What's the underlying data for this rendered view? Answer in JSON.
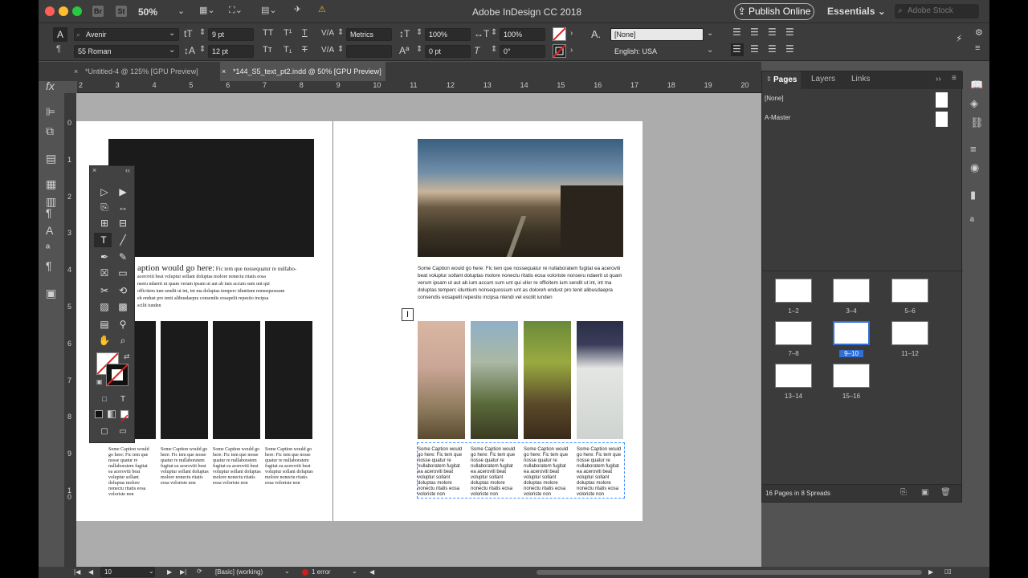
{
  "window": {
    "title": "Adobe InDesign CC 2018",
    "zoom": "50%",
    "workspace": "Essentials",
    "publish": "Publish Online",
    "stock_placeholder": "Adobe Stock"
  },
  "appbar": {
    "br": "Br",
    "st": "St"
  },
  "control": {
    "font_family": "Avenir",
    "font_style": "55 Roman",
    "size": "9 pt",
    "leading": "12 pt",
    "kerning": "Metrics",
    "vscale": "100%",
    "hscale": "100%",
    "baseline": "0 pt",
    "skew": "0°",
    "char_style": "[None]",
    "language": "English: USA"
  },
  "tabs": [
    "*Untitled-4 @ 125% [GPU Preview]",
    "*144_S5_text_pt2.indd @ 50% [GPU Preview]"
  ],
  "ruler_h": [
    "2",
    "3",
    "4",
    "5",
    "6",
    "7",
    "8",
    "9",
    "10",
    "11",
    "12",
    "13",
    "14",
    "15",
    "16",
    "17",
    "18",
    "19",
    "20"
  ],
  "ruler_v": [
    "0",
    "1",
    "2",
    "3",
    "4",
    "5",
    "6",
    "7",
    "8",
    "9",
    "1\n0"
  ],
  "doc": {
    "caption_lead": "Some Caption would go here:",
    "caption_lead_left": "aption would go here:",
    "caption_body": "Fic tem que nossequatur re nullaboratem fugitat ea aceroviti beat voluptur sollant doluptas molore nonectu ritatis eosa voloriste nonseru ndaerit ut quam verum ipsam ut aut ab ium accum sum unt qui ullor re officitem ium sendit ut int, int ma doluptas temperc iduntium nonsequossum unt as doloreh endust pro tenit alibusdaepra consendis eosapelit repestio incipsa ntendi vel escilit iunden",
    "caption_left_lines": [
      "aceroviti beat voluptur sollant doluptas molore nonectu ritatis eosa",
      "nseru ndaerit ut quam verum ipsam ut aut ab ium accum sum unt qui",
      "officitem ium sendit ut int, int ma doluptas temperc iduntium nonsequossum",
      "eh endust pro tenit alibusdaepra consendis eosapelit repestio incipsa",
      "scilit iunden"
    ],
    "small_caption": "Some Caption would go here: Fic tem que nosse quatur re nullaboratem fugitat ea aceroviti beat voluptur sollant doluptas molore nonectu ritatis eosa voloriste non",
    "small_caption_left": "Some Caption would go here: Fic tem que nosse quatur re nullaboratem fugitat ea aceroviti beat voluptur sollant doluptas molore nonectu ritatis eosa voloriste non"
  },
  "pages_panel": {
    "tabs": [
      "Pages",
      "Layers",
      "Links"
    ],
    "masters": [
      "[None]",
      "A-Master"
    ],
    "spreads": [
      "1–2",
      "3–4",
      "5–6",
      "7–8",
      "9–10",
      "11–12",
      "13–14",
      "15–16"
    ],
    "summary": "16 Pages in 8 Spreads"
  },
  "status": {
    "page": "10",
    "preflight": "[Basic] (working)",
    "errors": "1 error"
  },
  "colors": {
    "accent": "#2f6fd6",
    "error": "#d01c1c",
    "selection": "#3d8bff"
  }
}
